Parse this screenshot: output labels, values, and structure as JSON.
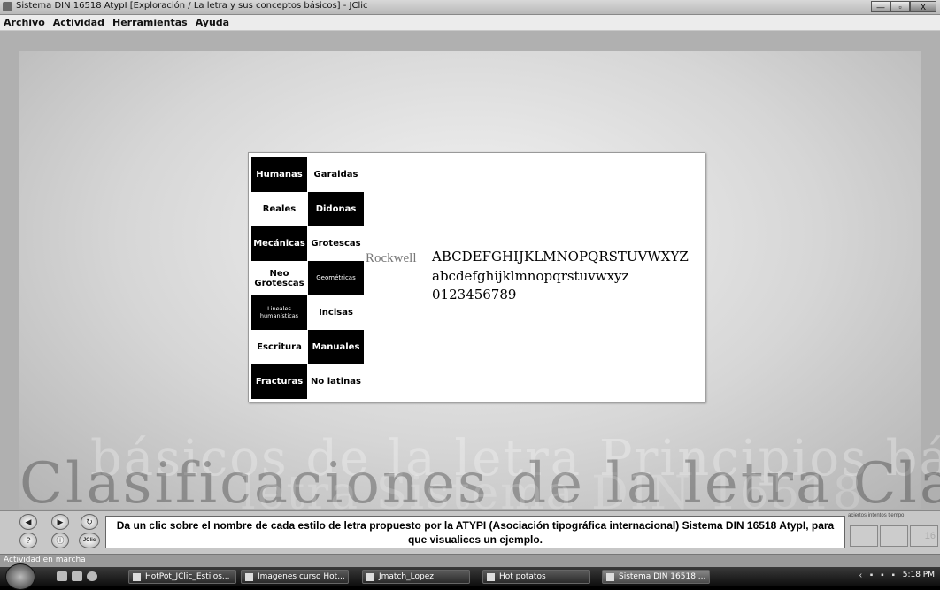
{
  "window": {
    "title": "Sistema DIN 16518 AtypI [Exploración / La letra y sus conceptos básicos] - JClic",
    "minimize": "—",
    "maximize": "▫",
    "close": "X"
  },
  "menu": [
    {
      "label": "Archivo"
    },
    {
      "label": "Actividad"
    },
    {
      "label": "Herramientas"
    },
    {
      "label": "Ayuda"
    }
  ],
  "background": {
    "line1": "básicos de la letra Principios bá",
    "line2": "Clasificaciones de la letra Clasific",
    "line3": "letra Sistema DIN 16518"
  },
  "grid": {
    "col1": [
      {
        "label": "Humanas",
        "style": "black"
      },
      {
        "label": "Reales",
        "style": "white"
      },
      {
        "label": "Mecánicas",
        "style": "black"
      },
      {
        "label": "Neo Grotescas",
        "style": "white"
      },
      {
        "label": "Lineales humanísticas",
        "style": "black"
      },
      {
        "label": "Escritura",
        "style": "white"
      },
      {
        "label": "Fracturas",
        "style": "black"
      }
    ],
    "col2": [
      {
        "label": "Garaldas",
        "style": "white"
      },
      {
        "label": "Didonas",
        "style": "black"
      },
      {
        "label": "Grotescas",
        "style": "white"
      },
      {
        "label": "Geométricas",
        "style": "black"
      },
      {
        "label": "Incisas",
        "style": "white"
      },
      {
        "label": "Manuales",
        "style": "black"
      },
      {
        "label": "No latinas",
        "style": "white"
      }
    ]
  },
  "sample": {
    "font_name": "Rockwell",
    "upper": "ABCDEFGHIJKLMNOPQRSTUVWXYZ",
    "lower": "abcdefghijklmnopqrstuvwxyz",
    "digits": "0123456789"
  },
  "controls": {
    "prev_icon": "◀",
    "next_icon": "▶",
    "restart_icon": "↻",
    "help_icon": "?",
    "info_icon": "ⓘ",
    "jclic_label": "JClic"
  },
  "message": "Da un clic sobre el nombre de cada estilo de letra propuesto por la ATYPI (Asociación tipográfica internacional) Sistema DIN 16518 AtypI, para que visualices un ejemplo.",
  "counters": {
    "labels": "aciertos  intentos  tiempo",
    "aciertos": "",
    "intentos": "",
    "tiempo": "16"
  },
  "status": "Actividad en marcha",
  "taskbar": {
    "tasks": [
      {
        "label": "HotPot_JClic_Estilos..."
      },
      {
        "label": "Imagenes curso Hot..."
      },
      {
        "label": "Jmatch_Lopez"
      },
      {
        "label": "Hot potatos"
      },
      {
        "label": "Sistema DIN 16518 ..."
      }
    ],
    "clock": "5:18 PM"
  }
}
